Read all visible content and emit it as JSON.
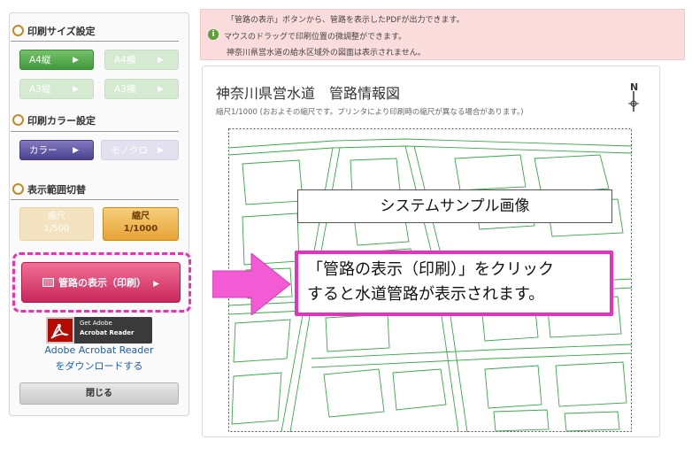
{
  "left_panel": {
    "size_section": {
      "title": "印刷サイズ設定",
      "buttons": [
        {
          "label": "A4縦",
          "active": true
        },
        {
          "label": "A4横",
          "active": false
        },
        {
          "label": "A3縦",
          "active": false
        },
        {
          "label": "A3横",
          "active": false
        }
      ]
    },
    "color_section": {
      "title": "印刷カラー設定",
      "buttons": [
        {
          "label": "カラー",
          "active": true
        },
        {
          "label": "モノクロ",
          "active": false
        }
      ]
    },
    "range_section": {
      "title": "表示範囲切替",
      "buttons": [
        {
          "line1": "縮尺",
          "line2": "1/500",
          "active": false
        },
        {
          "line1": "縮尺",
          "line2": "1/1000",
          "active": true
        }
      ]
    },
    "print_button": "管路の表示（印刷）",
    "adobe": {
      "badge_line1": "Get Adobe",
      "badge_line2": "Acrobat Reader",
      "link_line1": "Adobe Acrobat Reader",
      "link_line2": "をダウンロードする"
    },
    "close_button": "閉じる"
  },
  "notice": {
    "line1": "「管路の表示」ボタンから、管路を表示したPDFが出力できます。",
    "line2": "マウスのドラッグで印刷位置の微調整ができます。",
    "line3": "神奈川県営水道の給水区域外の図面は表示されません。",
    "icon": "info-icon"
  },
  "map": {
    "title": "神奈川県営水道　管路情報図",
    "scale_note": "縮尺1/1000 (おおよその縮尺です。プリンタにより印刷時の縮尺が異なる場合があります。)",
    "north_label": "N"
  },
  "overlay": {
    "sample_label": "システムサンプル画像",
    "callout_line1": "「管路の表示（印刷）」をクリック",
    "callout_line2": "すると水道管路が表示されます。"
  },
  "colors": {
    "highlight": "#f02fb8",
    "map_lines": "#3aa84a",
    "print_button": "#d63a6a"
  }
}
